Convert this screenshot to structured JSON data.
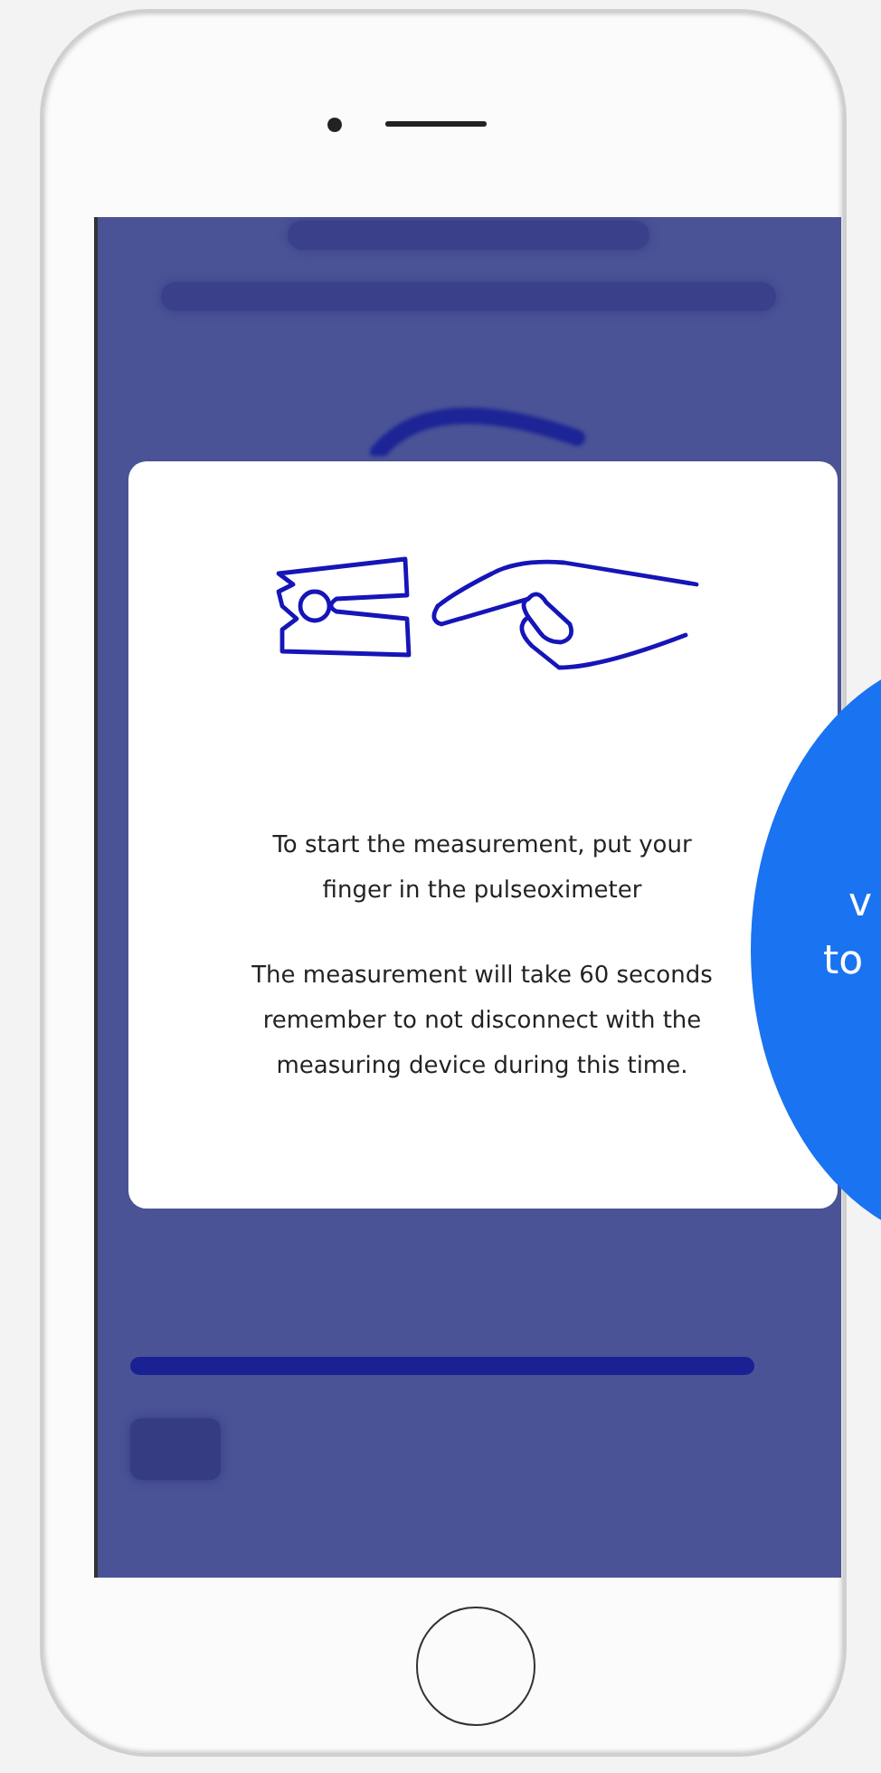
{
  "background_screen": {
    "pulse_bar": {
      "level": 1
    }
  },
  "dialog": {
    "instruction": "To start the measurement, put your finger in the pulseoximeter",
    "note": "The measurement will take 60 seconds remember to not disconnect with the measuring device during this time."
  },
  "side_bubble": {
    "lines": [
      "v",
      "to"
    ]
  }
}
